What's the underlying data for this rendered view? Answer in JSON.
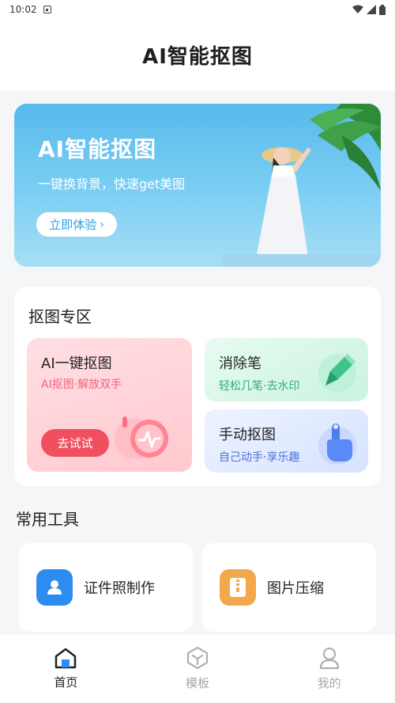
{
  "status_bar": {
    "time": "10:02"
  },
  "header": {
    "title": "AI智能抠图"
  },
  "banner": {
    "title": "AI智能抠图",
    "subtitle": "一键换背景，快速get美图",
    "button_label": "立即体验",
    "button_chevron": "›"
  },
  "matting_zone": {
    "title": "抠图专区",
    "ai_cutout": {
      "title": "AI一键抠图",
      "subtitle": "AI抠图·解放双手",
      "button_label": "去试试"
    },
    "eraser": {
      "title": "消除笔",
      "subtitle": "轻松几笔·去水印"
    },
    "manual_cutout": {
      "title": "手动抠图",
      "subtitle": "自己动手·享乐趣"
    }
  },
  "tools": {
    "title": "常用工具",
    "items": [
      {
        "label": "证件照制作",
        "icon": "id-photo-icon",
        "color": "#2d8cf0"
      },
      {
        "label": "图片压缩",
        "icon": "compress-icon",
        "color": "#f2a84b"
      }
    ]
  },
  "bottom_nav": {
    "items": [
      {
        "label": "首页",
        "icon": "home-icon",
        "active": true
      },
      {
        "label": "模板",
        "icon": "template-icon",
        "active": false
      },
      {
        "label": "我的",
        "icon": "profile-icon",
        "active": false
      }
    ]
  },
  "colors": {
    "accent_red": "#f04f5f",
    "accent_blue": "#2d8cf0",
    "accent_green": "#2fae79",
    "inactive_gray": "#a8a8a8"
  }
}
